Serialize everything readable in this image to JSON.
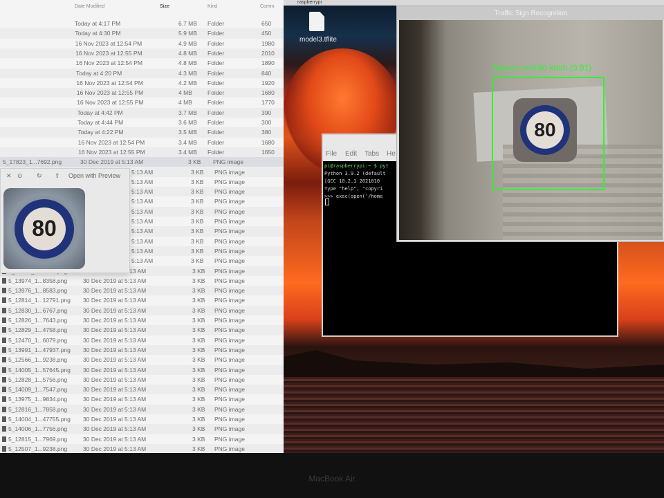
{
  "desktop": {
    "file_name": "model3.tflite",
    "bezel_label": "MacBook Air",
    "menubar_tabs": [
      "raspberrypi",
      "",
      "Traffic Sign Recognition"
    ]
  },
  "finder": {
    "columns": {
      "date": "Date Modified",
      "size": "Size",
      "kind": "Kind",
      "comments": "Comm"
    },
    "folder_rows": [
      {
        "date": "Today at 4:17 PM",
        "size": "6.7 MB",
        "kind": "Folder",
        "count": "650"
      },
      {
        "date": "Today at 4:30 PM",
        "size": "5.9 MB",
        "kind": "Folder",
        "count": "450"
      },
      {
        "date": "16 Nov 2023 at 12:54 PM",
        "size": "4.9 MB",
        "kind": "Folder",
        "count": "1980"
      },
      {
        "date": "16 Nov 2023 at 12:55 PM",
        "size": "4.8 MB",
        "kind": "Folder",
        "count": "2010"
      },
      {
        "date": "16 Nov 2023 at 12:54 PM",
        "size": "4.8 MB",
        "kind": "Folder",
        "count": "1890"
      },
      {
        "date": "Today at 4:20 PM",
        "size": "4.3 MB",
        "kind": "Folder",
        "count": "840"
      },
      {
        "date": "16 Nov 2023 at 12:54 PM",
        "size": "4.2 MB",
        "kind": "Folder",
        "count": "1920"
      },
      {
        "date": "16 Nov 2023 at 12:55 PM",
        "size": "4 MB",
        "kind": "Folder",
        "count": "1680"
      },
      {
        "date": "16 Nov 2023 at 12:55 PM",
        "size": "4 MB",
        "kind": "Folder",
        "count": "1770"
      },
      {
        "date": "Today at 4:42 PM",
        "size": "3.7 MB",
        "kind": "Folder",
        "count": "390"
      },
      {
        "date": "Today at 4:44 PM",
        "size": "3.6 MB",
        "kind": "Folder",
        "count": "300"
      },
      {
        "date": "Today at 4:22 PM",
        "size": "3.5 MB",
        "kind": "Folder",
        "count": "380"
      },
      {
        "date": "16 Nov 2023 at 12:54 PM",
        "size": "3.4 MB",
        "kind": "Folder",
        "count": "1680"
      },
      {
        "date": "16 Nov 2023 at 12:55 PM",
        "size": "3.4 MB",
        "kind": "Folder",
        "count": "1650"
      }
    ],
    "selected_row": {
      "name": "5_17823_1...7692.png",
      "date": "30 Dec 2019 at 5:13 AM",
      "size": "3 KB",
      "kind": "PNG image"
    },
    "hidden_rows": [
      {
        "date": "5:13 AM",
        "size": "3 KB",
        "kind": "PNG image"
      },
      {
        "date": "5:13 AM",
        "size": "3 KB",
        "kind": "PNG image"
      },
      {
        "date": "5:13 AM",
        "size": "3 KB",
        "kind": "PNG image"
      },
      {
        "date": "5:13 AM",
        "size": "3 KB",
        "kind": "PNG image"
      },
      {
        "date": "5:13 AM",
        "size": "3 KB",
        "kind": "PNG image"
      },
      {
        "date": "5:13 AM",
        "size": "3 KB",
        "kind": "PNG image"
      },
      {
        "date": "5:13 AM",
        "size": "3 KB",
        "kind": "PNG image"
      },
      {
        "date": "5:13 AM",
        "size": "3 KB",
        "kind": "PNG image"
      },
      {
        "date": "5:13 AM",
        "size": "3 KB",
        "kind": "PNG image"
      },
      {
        "date": "5:13 AM",
        "size": "3 KB",
        "kind": "PNG image"
      }
    ],
    "file_rows": [
      {
        "name": "5_12824_1...7692.png",
        "date": "30 Dec 2019 at 5:13 AM",
        "size": "3 KB",
        "kind": "PNG image"
      },
      {
        "name": "5_13974_1...8358.png",
        "date": "30 Dec 2019 at 5:13 AM",
        "size": "3 KB",
        "kind": "PNG image"
      },
      {
        "name": "5_13976_1...8583.png",
        "date": "30 Dec 2019 at 5:13 AM",
        "size": "3 KB",
        "kind": "PNG image"
      },
      {
        "name": "5_12814_1...12791.png",
        "date": "30 Dec 2019 at 5:13 AM",
        "size": "3 KB",
        "kind": "PNG image"
      },
      {
        "name": "5_12830_1...6767.png",
        "date": "30 Dec 2019 at 5:13 AM",
        "size": "3 KB",
        "kind": "PNG image"
      },
      {
        "name": "5_12826_1...7643.png",
        "date": "30 Dec 2019 at 5:13 AM",
        "size": "3 KB",
        "kind": "PNG image"
      },
      {
        "name": "5_12829_1...4758.png",
        "date": "30 Dec 2019 at 5:13 AM",
        "size": "3 KB",
        "kind": "PNG image"
      },
      {
        "name": "5_12470_1...6079.png",
        "date": "30 Dec 2019 at 5:13 AM",
        "size": "3 KB",
        "kind": "PNG image"
      },
      {
        "name": "5_13991_1...47937.png",
        "date": "30 Dec 2019 at 5:13 AM",
        "size": "3 KB",
        "kind": "PNG image"
      },
      {
        "name": "5_12566_1...9238.png",
        "date": "30 Dec 2019 at 5:13 AM",
        "size": "3 KB",
        "kind": "PNG image"
      },
      {
        "name": "5_14005_1...57645.png",
        "date": "30 Dec 2019 at 5:13 AM",
        "size": "3 KB",
        "kind": "PNG image"
      },
      {
        "name": "5_12828_1...5756.png",
        "date": "30 Dec 2019 at 5:13 AM",
        "size": "3 KB",
        "kind": "PNG image"
      },
      {
        "name": "5_14009_1...7547.png",
        "date": "30 Dec 2019 at 5:13 AM",
        "size": "3 KB",
        "kind": "PNG image"
      },
      {
        "name": "5_13975_1...9834.png",
        "date": "30 Dec 2019 at 5:13 AM",
        "size": "3 KB",
        "kind": "PNG image"
      },
      {
        "name": "5_12816_1...7858.png",
        "date": "30 Dec 2019 at 5:13 AM",
        "size": "3 KB",
        "kind": "PNG image"
      },
      {
        "name": "5_14004_1...47755.png",
        "date": "30 Dec 2019 at 5:13 AM",
        "size": "3 KB",
        "kind": "PNG image"
      },
      {
        "name": "5_14006_1...7756.png",
        "date": "30 Dec 2019 at 5:13 AM",
        "size": "3 KB",
        "kind": "PNG image"
      },
      {
        "name": "5_12815_1...7969.png",
        "date": "30 Dec 2019 at 5:13 AM",
        "size": "3 KB",
        "kind": "PNG image"
      },
      {
        "name": "5_12507_1...9238.png",
        "date": "30 Dec 2019 at 5:13 AM",
        "size": "3 KB",
        "kind": "PNG image"
      }
    ]
  },
  "preview": {
    "open_label": "Open with Preview",
    "sign_number": "80"
  },
  "terminal": {
    "menu": [
      "File",
      "Edit",
      "Tabs",
      "He"
    ],
    "lines": [
      "pi@raspberrypi:~ $ pyt",
      "Python 3.9.2 (default",
      "[GCC 10.2.1 2021010",
      "Type \"help\", \"copyri",
      ">>> exec(open('/home"
    ]
  },
  "camera": {
    "title": "Traffic Sign Recognition",
    "detection_label": "Speed Limit 80 km/h (0.91)",
    "sign_number": "80",
    "box_color": "#2df52d"
  }
}
